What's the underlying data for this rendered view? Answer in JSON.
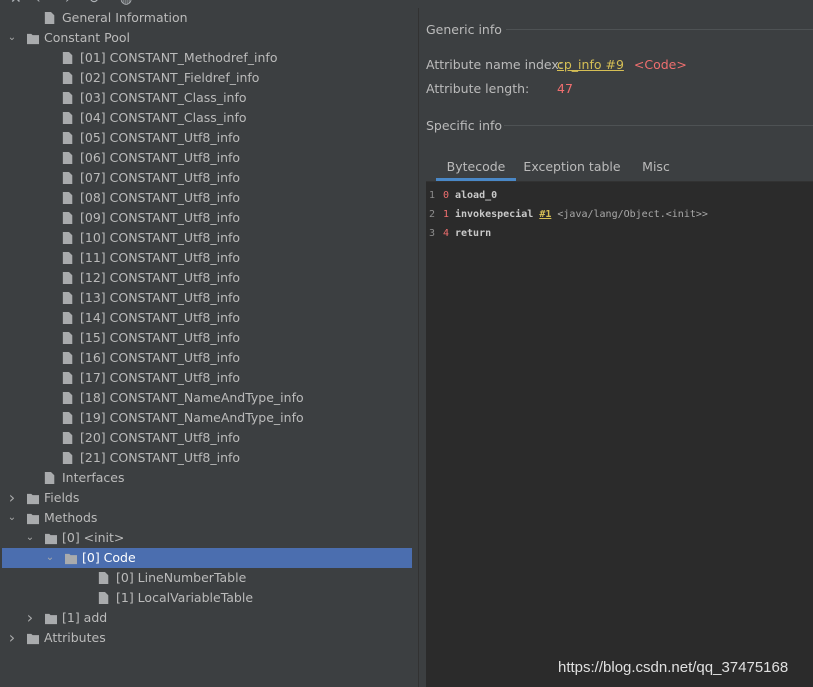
{
  "toolbar": {
    "icons": [
      "close-icon",
      "back-icon",
      "forward-icon",
      "refresh-icon",
      "web-icon"
    ]
  },
  "tree": {
    "rows": [
      {
        "label": "General Information",
        "icon": "file",
        "depth": 1,
        "arrow": ""
      },
      {
        "label": "Constant Pool",
        "icon": "folder",
        "depth": 0,
        "arrow": "expanded"
      },
      {
        "label": "[01] CONSTANT_Methodref_info",
        "icon": "file",
        "depth": 2,
        "arrow": ""
      },
      {
        "label": "[02] CONSTANT_Fieldref_info",
        "icon": "file",
        "depth": 2,
        "arrow": ""
      },
      {
        "label": "[03] CONSTANT_Class_info",
        "icon": "file",
        "depth": 2,
        "arrow": ""
      },
      {
        "label": "[04] CONSTANT_Class_info",
        "icon": "file",
        "depth": 2,
        "arrow": ""
      },
      {
        "label": "[05] CONSTANT_Utf8_info",
        "icon": "file",
        "depth": 2,
        "arrow": ""
      },
      {
        "label": "[06] CONSTANT_Utf8_info",
        "icon": "file",
        "depth": 2,
        "arrow": ""
      },
      {
        "label": "[07] CONSTANT_Utf8_info",
        "icon": "file",
        "depth": 2,
        "arrow": ""
      },
      {
        "label": "[08] CONSTANT_Utf8_info",
        "icon": "file",
        "depth": 2,
        "arrow": ""
      },
      {
        "label": "[09] CONSTANT_Utf8_info",
        "icon": "file",
        "depth": 2,
        "arrow": ""
      },
      {
        "label": "[10] CONSTANT_Utf8_info",
        "icon": "file",
        "depth": 2,
        "arrow": ""
      },
      {
        "label": "[11] CONSTANT_Utf8_info",
        "icon": "file",
        "depth": 2,
        "arrow": ""
      },
      {
        "label": "[12] CONSTANT_Utf8_info",
        "icon": "file",
        "depth": 2,
        "arrow": ""
      },
      {
        "label": "[13] CONSTANT_Utf8_info",
        "icon": "file",
        "depth": 2,
        "arrow": ""
      },
      {
        "label": "[14] CONSTANT_Utf8_info",
        "icon": "file",
        "depth": 2,
        "arrow": ""
      },
      {
        "label": "[15] CONSTANT_Utf8_info",
        "icon": "file",
        "depth": 2,
        "arrow": ""
      },
      {
        "label": "[16] CONSTANT_Utf8_info",
        "icon": "file",
        "depth": 2,
        "arrow": ""
      },
      {
        "label": "[17] CONSTANT_Utf8_info",
        "icon": "file",
        "depth": 2,
        "arrow": ""
      },
      {
        "label": "[18] CONSTANT_NameAndType_info",
        "icon": "file",
        "depth": 2,
        "arrow": ""
      },
      {
        "label": "[19] CONSTANT_NameAndType_info",
        "icon": "file",
        "depth": 2,
        "arrow": ""
      },
      {
        "label": "[20] CONSTANT_Utf8_info",
        "icon": "file",
        "depth": 2,
        "arrow": ""
      },
      {
        "label": "[21] CONSTANT_Utf8_info",
        "icon": "file",
        "depth": 2,
        "arrow": ""
      },
      {
        "label": "Interfaces",
        "icon": "file",
        "depth": 1,
        "arrow": ""
      },
      {
        "label": "Fields",
        "icon": "folder",
        "depth": 0,
        "arrow": "collapsed"
      },
      {
        "label": "Methods",
        "icon": "folder",
        "depth": 0,
        "arrow": "expanded"
      },
      {
        "label": "[0] <init>",
        "icon": "folder",
        "depth": 1,
        "arrow": "expanded"
      },
      {
        "label": "[0] Code",
        "icon": "folder",
        "depth": 2,
        "arrow": "expanded",
        "selected": true
      },
      {
        "label": "[0] LineNumberTable",
        "icon": "file",
        "depth": 4,
        "arrow": ""
      },
      {
        "label": "[1] LocalVariableTable",
        "icon": "file",
        "depth": 4,
        "arrow": ""
      },
      {
        "label": "[1] add",
        "icon": "folder",
        "depth": 1,
        "arrow": "collapsed"
      },
      {
        "label": "Attributes",
        "icon": "folder",
        "depth": 0,
        "arrow": "collapsed"
      }
    ]
  },
  "generic": {
    "title": "Generic info",
    "name_index_label": "Attribute name index:",
    "name_index_link": "cp_info #9",
    "name_index_value": "<Code>",
    "length_label": "Attribute length:",
    "length_value": "47"
  },
  "specific": {
    "title": "Specific info",
    "tabs": [
      "Bytecode",
      "Exception table",
      "Misc"
    ],
    "active_tab": "Bytecode"
  },
  "bytecode": [
    {
      "line": "1",
      "offset": "0",
      "instr": "aload_0",
      "operand": "",
      "comment": ""
    },
    {
      "line": "2",
      "offset": "1",
      "instr": "invokespecial",
      "operand": "#1",
      "comment": "<java/lang/Object.<init>>"
    },
    {
      "line": "3",
      "offset": "4",
      "instr": "return",
      "operand": "",
      "comment": ""
    }
  ],
  "watermark": "https://blog.csdn.net/qq_37475168",
  "colors": {
    "background": "#3c3f41",
    "selection": "#4b6eaf",
    "link": "#d6bf55",
    "accent_red": "#f06f6f",
    "tab_underline": "#4a88c7",
    "code_bg": "#2b2b2b"
  }
}
